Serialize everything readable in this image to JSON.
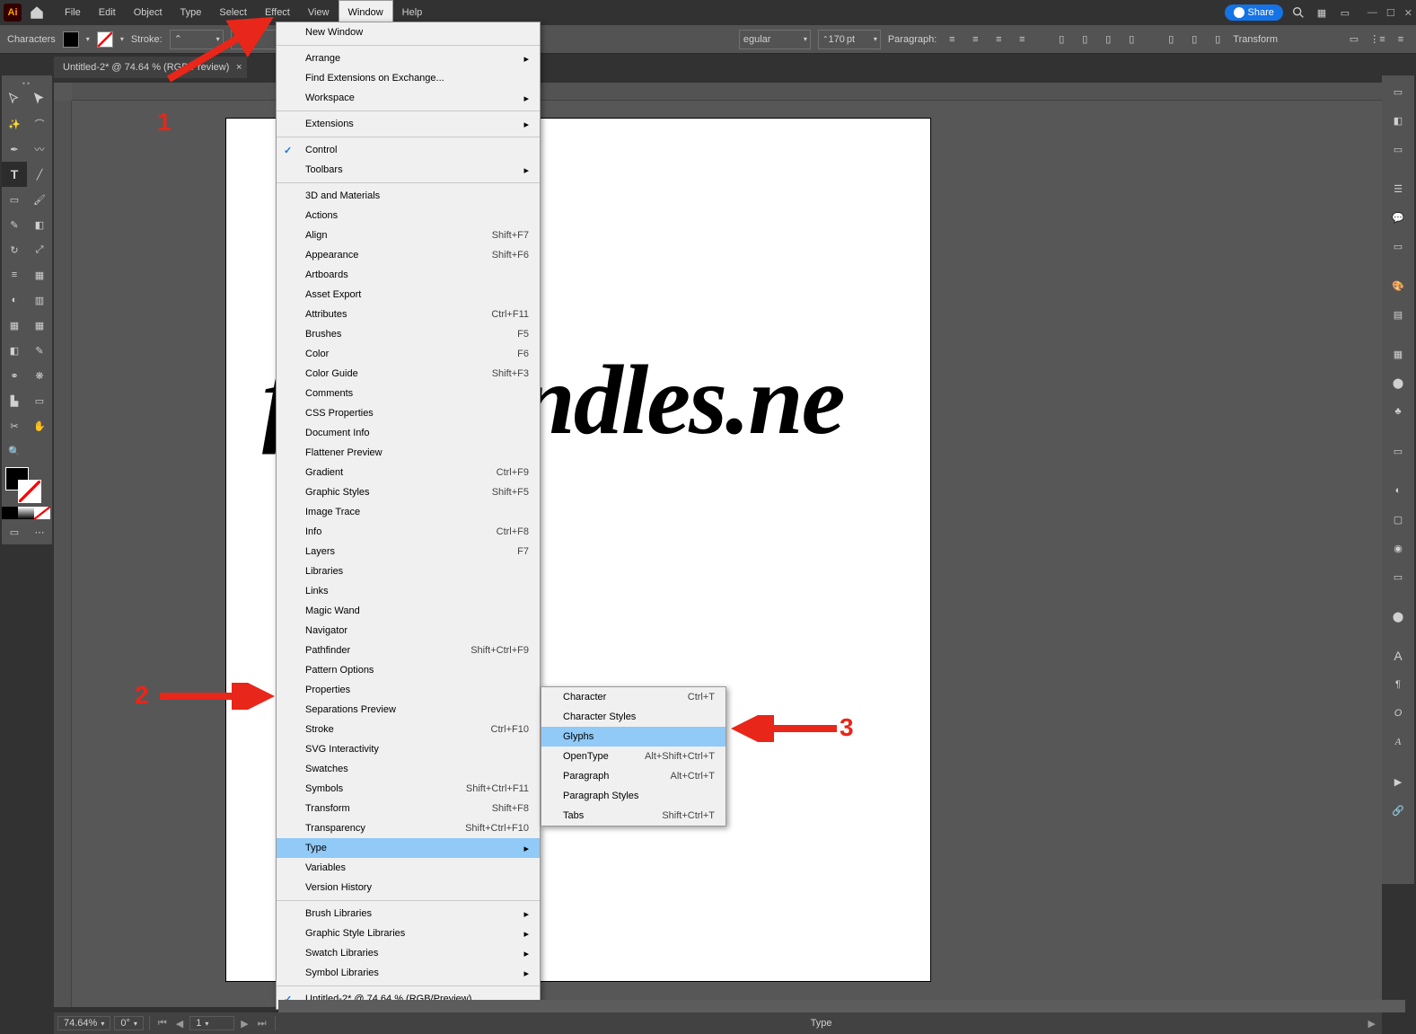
{
  "menubar": {
    "app_abbr": "Ai",
    "items": [
      "File",
      "Edit",
      "Object",
      "Type",
      "Select",
      "Effect",
      "View",
      "Window",
      "Help"
    ],
    "active_index": 7,
    "share_label": "Share"
  },
  "controlbar": {
    "mode_label": "Characters",
    "stroke_label": "Stroke:",
    "style_value": "egular",
    "weight_unit": "pt",
    "weight_value": "170",
    "paragraph_label": "Paragraph:",
    "transform_label": "Transform"
  },
  "doctab": {
    "title": "Untitled-2* @ 74.64 % (RGB/Preview)"
  },
  "artboard": {
    "text_content": "fontbundles.ne"
  },
  "window_menu": {
    "groups": [
      [
        {
          "label": "New Window"
        }
      ],
      [
        {
          "label": "Arrange",
          "submenu": true
        },
        {
          "label": "Find Extensions on Exchange..."
        },
        {
          "label": "Workspace",
          "submenu": true
        }
      ],
      [
        {
          "label": "Extensions",
          "submenu": true
        }
      ],
      [
        {
          "label": "Control",
          "checked": true
        },
        {
          "label": "Toolbars",
          "submenu": true
        }
      ],
      [
        {
          "label": "3D and Materials"
        },
        {
          "label": "Actions"
        },
        {
          "label": "Align",
          "shortcut": "Shift+F7"
        },
        {
          "label": "Appearance",
          "shortcut": "Shift+F6"
        },
        {
          "label": "Artboards"
        },
        {
          "label": "Asset Export"
        },
        {
          "label": "Attributes",
          "shortcut": "Ctrl+F11"
        },
        {
          "label": "Brushes",
          "shortcut": "F5"
        },
        {
          "label": "Color",
          "shortcut": "F6"
        },
        {
          "label": "Color Guide",
          "shortcut": "Shift+F3"
        },
        {
          "label": "Comments"
        },
        {
          "label": "CSS Properties"
        },
        {
          "label": "Document Info"
        },
        {
          "label": "Flattener Preview"
        },
        {
          "label": "Gradient",
          "shortcut": "Ctrl+F9"
        },
        {
          "label": "Graphic Styles",
          "shortcut": "Shift+F5"
        },
        {
          "label": "Image Trace"
        },
        {
          "label": "Info",
          "shortcut": "Ctrl+F8"
        },
        {
          "label": "Layers",
          "shortcut": "F7"
        },
        {
          "label": "Libraries"
        },
        {
          "label": "Links"
        },
        {
          "label": "Magic Wand"
        },
        {
          "label": "Navigator"
        },
        {
          "label": "Pathfinder",
          "shortcut": "Shift+Ctrl+F9"
        },
        {
          "label": "Pattern Options"
        },
        {
          "label": "Properties"
        },
        {
          "label": "Separations Preview"
        },
        {
          "label": "Stroke",
          "shortcut": "Ctrl+F10"
        },
        {
          "label": "SVG Interactivity"
        },
        {
          "label": "Swatches"
        },
        {
          "label": "Symbols",
          "shortcut": "Shift+Ctrl+F11"
        },
        {
          "label": "Transform",
          "shortcut": "Shift+F8"
        },
        {
          "label": "Transparency",
          "shortcut": "Shift+Ctrl+F10"
        },
        {
          "label": "Type",
          "submenu": true,
          "highlighted": true
        },
        {
          "label": "Variables"
        },
        {
          "label": "Version History"
        }
      ],
      [
        {
          "label": "Brush Libraries",
          "submenu": true
        },
        {
          "label": "Graphic Style Libraries",
          "submenu": true
        },
        {
          "label": "Swatch Libraries",
          "submenu": true
        },
        {
          "label": "Symbol Libraries",
          "submenu": true
        }
      ],
      [
        {
          "label": "Untitled-2* @ 74.64 % (RGB/Preview)",
          "checked": true
        }
      ]
    ]
  },
  "type_submenu": [
    {
      "label": "Character",
      "shortcut": "Ctrl+T"
    },
    {
      "label": "Character Styles"
    },
    {
      "label": "Glyphs",
      "highlighted": true
    },
    {
      "label": "OpenType",
      "shortcut": "Alt+Shift+Ctrl+T"
    },
    {
      "label": "Paragraph",
      "shortcut": "Alt+Ctrl+T"
    },
    {
      "label": "Paragraph Styles"
    },
    {
      "label": "Tabs",
      "shortcut": "Shift+Ctrl+T"
    }
  ],
  "statusbar": {
    "zoom": "74.64%",
    "rotate": "0°",
    "page": "1",
    "mode": "Type"
  },
  "annotations": {
    "n1": "1",
    "n2": "2",
    "n3": "3"
  }
}
